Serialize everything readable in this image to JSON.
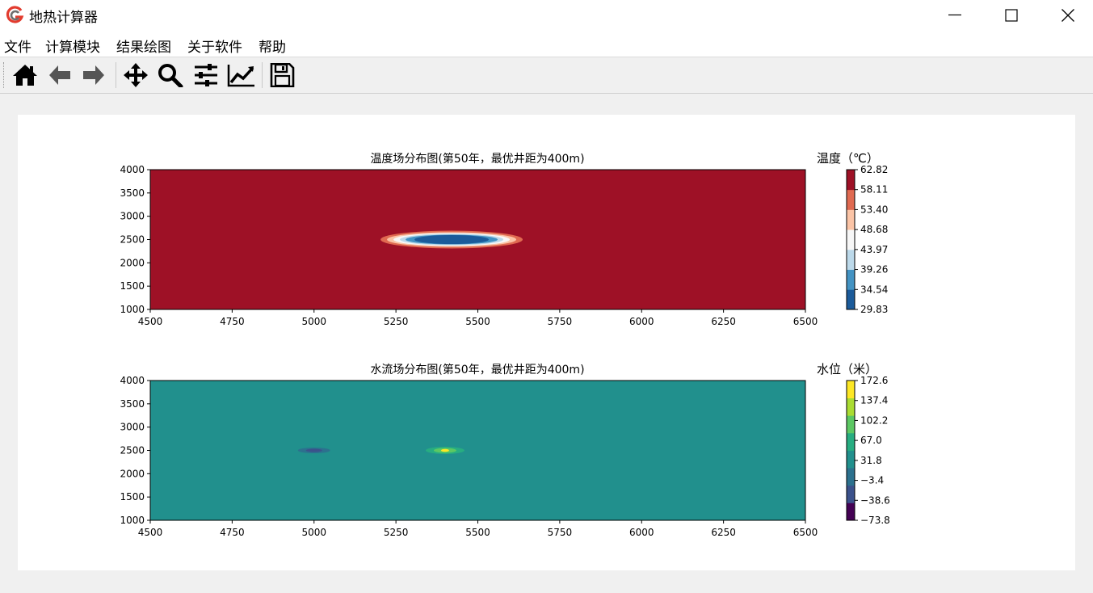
{
  "window": {
    "title": "地热计算器",
    "icons": [
      "app-logo-icon",
      "minimize-icon",
      "maximize-icon",
      "close-icon"
    ]
  },
  "menu": {
    "items": [
      {
        "label": "文件"
      },
      {
        "label": "计算模块"
      },
      {
        "label": "结果绘图"
      },
      {
        "label": "关于软件"
      },
      {
        "label": "帮助"
      }
    ]
  },
  "toolbar": {
    "buttons": [
      {
        "icon": "home-icon"
      },
      {
        "icon": "back-arrow-icon"
      },
      {
        "icon": "forward-arrow-icon"
      },
      {
        "icon": "pan-icon"
      },
      {
        "icon": "zoom-icon"
      },
      {
        "icon": "subplots-config-icon"
      },
      {
        "icon": "edit-curve-icon"
      },
      {
        "icon": "save-icon"
      }
    ]
  },
  "chart_data": [
    {
      "type": "heatmap",
      "title": "温度场分布图(第50年，最优井距为400m)",
      "colorbar_label": "温度（℃）",
      "xlim": [
        4500,
        6500
      ],
      "ylim": [
        1000,
        4000
      ],
      "xticks": [
        "4500",
        "4750",
        "5000",
        "5250",
        "5500",
        "5750",
        "6000",
        "6250",
        "6500"
      ],
      "yticks": [
        "1000",
        "1500",
        "2000",
        "2500",
        "3000",
        "3500",
        "4000"
      ],
      "colorbar_ticks": [
        "29.83",
        "34.54",
        "39.26",
        "43.97",
        "48.68",
        "53.40",
        "58.11",
        "62.82"
      ],
      "colors": [
        "#1b5b9a",
        "#4393c3",
        "#bcd9ea",
        "#f7f7f7",
        "#fbc4a6",
        "#e06a51",
        "#9e1126"
      ],
      "background_value": 62.82,
      "anomaly": {
        "center_x": 5420,
        "center_y": 2500,
        "min_value": 29.83,
        "shape": "ellipse"
      }
    },
    {
      "type": "heatmap",
      "title": "水流场分布图(第50年，最优井距为400m)",
      "colorbar_label": "水位（米）",
      "xlim": [
        4500,
        6500
      ],
      "ylim": [
        1000,
        4000
      ],
      "xticks": [
        "4500",
        "4750",
        "5000",
        "5250",
        "5500",
        "5750",
        "6000",
        "6250",
        "6500"
      ],
      "yticks": [
        "1000",
        "1500",
        "2000",
        "2500",
        "3000",
        "3500",
        "4000"
      ],
      "colorbar_ticks": [
        "172.6",
        "137.4",
        "102.2",
        "67.0",
        "31.8",
        "−3.4",
        "−38.6",
        "−73.8"
      ],
      "colors": [
        "#440154",
        "#3b518b",
        "#2c718e",
        "#21908d",
        "#27ad81",
        "#5cc863",
        "#aadc32",
        "#fde725"
      ],
      "background_value": 49.4,
      "wells": [
        {
          "type": "extraction",
          "x": 5000,
          "y": 2500,
          "value": -73.8
        },
        {
          "type": "injection",
          "x": 5400,
          "y": 2500,
          "value": 172.6
        }
      ]
    }
  ]
}
